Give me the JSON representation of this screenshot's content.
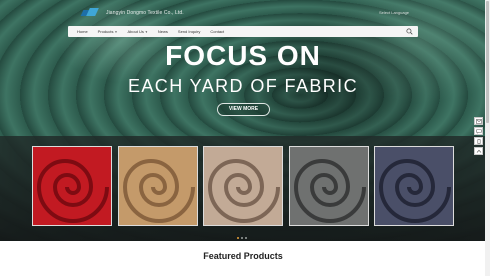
{
  "header": {
    "company_name": "Jiangyin Dongmo Textile Co., Ltd.",
    "language": "Select Language"
  },
  "nav": {
    "items": [
      {
        "label": "Home",
        "dropdown": false
      },
      {
        "label": "Products",
        "dropdown": true
      },
      {
        "label": "About Us",
        "dropdown": true
      },
      {
        "label": "News",
        "dropdown": false
      },
      {
        "label": "Send Inquiry",
        "dropdown": false
      },
      {
        "label": "Contact",
        "dropdown": false
      }
    ],
    "search_icon": "search-icon"
  },
  "hero": {
    "title": "FOCUS ON",
    "subtitle": "EACH YARD OF FABRIC",
    "button_label": "VIEW MORE"
  },
  "products": [
    {
      "name": "red fabric",
      "color": "#c21a22",
      "shade": "#7e0b12"
    },
    {
      "name": "tan fabric",
      "color": "#c49a6a",
      "shade": "#8a6440"
    },
    {
      "name": "beige fabric",
      "color": "#c2aa96",
      "shade": "#7d6656"
    },
    {
      "name": "gray fabric",
      "color": "#6f7170",
      "shade": "#3a3b3b"
    },
    {
      "name": "navy fabric",
      "color": "#4a4f68",
      "shade": "#25283a"
    }
  ],
  "carousel": {
    "slides": 3,
    "active_index": 0
  },
  "side_tools": [
    "mail-icon",
    "chat-icon",
    "phone-icon",
    "top-icon"
  ],
  "featured_heading": "Featured Products"
}
